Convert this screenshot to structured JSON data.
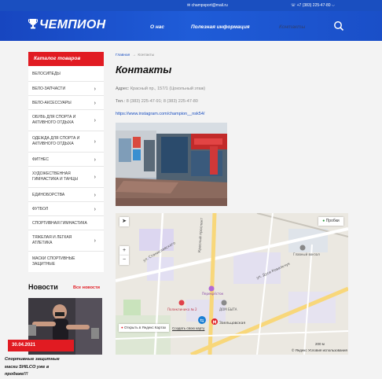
{
  "topbar": {
    "email": "✉ champsport@mail.ru",
    "phone": "☏ +7 (383) 225-47-80 ⌵"
  },
  "header": {
    "logo": "ЧЕМПИОН",
    "nav": [
      "О нас",
      "Полезная информация",
      "Контакты"
    ]
  },
  "sidebar": {
    "title": "Каталог товаров",
    "items": [
      {
        "label": "ВЕЛОСИПЕДЫ",
        "chev": false
      },
      {
        "label": "ВЕЛО-ЗАПЧАСТИ",
        "chev": true
      },
      {
        "label": "ВЕЛО-АКСЕССУАРЫ",
        "chev": true
      },
      {
        "label": "ОБУВЬ ДЛЯ СПОРТА И АКТИВНОГО ОТДЫХА",
        "chev": true
      },
      {
        "label": "ОДЕЖДА ДЛЯ СПОРТА И АКТИВНОГО ОТДЫХА",
        "chev": true
      },
      {
        "label": "ФИТНЕС",
        "chev": true
      },
      {
        "label": "ХУДОЖЕСТВЕННАЯ ГИМНАСТИКА И ТАНЦЫ",
        "chev": true
      },
      {
        "label": "ЕДИНОБОРСТВА",
        "chev": true
      },
      {
        "label": "ФУТБОЛ",
        "chev": true
      },
      {
        "label": "СПОРТИВНАЯ ГИМНАСТИКА",
        "chev": false
      },
      {
        "label": "ТЯЖЕЛАЯ И ЛЕГКАЯ АТЛЕТИКА",
        "chev": true
      },
      {
        "label": "МАСКИ СПОРТИВНЫЕ ЗАЩИТНЫЕ",
        "chev": false
      }
    ]
  },
  "news": {
    "title": "Новости",
    "all_label": "Все новости",
    "date": "30.04.2021",
    "text": "Спортивные защитные маски SHILCO уже в продаже!!!"
  },
  "breadcrumb": {
    "home": "Главная",
    "sep": "→",
    "current": "Контакты"
  },
  "page_title": "Контакты",
  "contacts": {
    "address_label": "Адрес:",
    "address": "Красный пр., 157/1 (Цокольный этаж)",
    "phone_label": "Тел.:",
    "phones": "8 (383) 225-47-91; 8 (383) 225-47-80",
    "instagram": "https://www.instagram.com/champion__nsk54/"
  },
  "map": {
    "traffic_label": "Пробки",
    "open_label": "Открыть в Яндекс Картах",
    "create_label": "Создать свою карту",
    "scale": "200 м",
    "copyright": "© Яндекс Условия использования",
    "labels": {
      "avenue": "Красный проспект",
      "stanislavskogo": "ул. Станиславского",
      "kokkinaki": "ул. Дуси Ковальчук",
      "main_square": "Главный вокзал",
      "perekrestok": "Перекрёсток",
      "hospital": "Поликлиника № 2",
      "metro": "Заельцовская",
      "dom": "ДОМ БЫТА"
    }
  },
  "colors": {
    "brand_blue": "#1a4fc0",
    "accent_red": "#e11b22"
  }
}
